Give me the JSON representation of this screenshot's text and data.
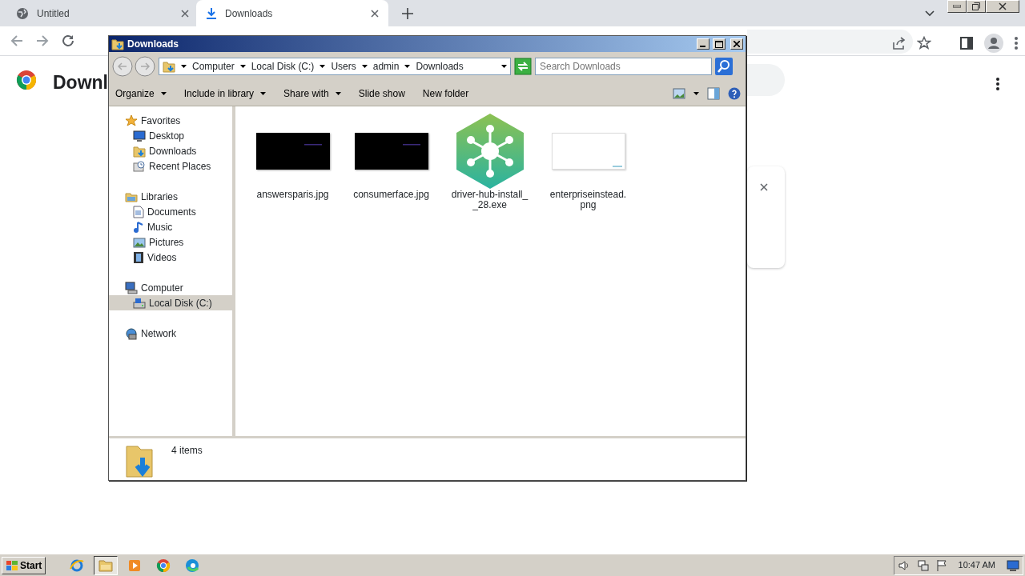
{
  "browser": {
    "tabs": [
      {
        "title": "Untitled",
        "kind": "globe",
        "selected": false
      },
      {
        "title": "Downloads",
        "kind": "download",
        "selected": true
      }
    ]
  },
  "page": {
    "title": "Downl"
  },
  "explorer": {
    "title": "Downloads",
    "breadcrumb": [
      "Computer",
      "Local Disk (C:)",
      "Users",
      "admin",
      "Downloads"
    ],
    "search": {
      "placeholder": "Search Downloads"
    },
    "commands": [
      {
        "label": "Organize",
        "dropdown": true
      },
      {
        "label": "Include in library",
        "dropdown": true
      },
      {
        "label": "Share with",
        "dropdown": true
      },
      {
        "label": "Slide show",
        "dropdown": false
      },
      {
        "label": "New folder",
        "dropdown": false
      }
    ],
    "sidebar": [
      {
        "label": "Favorites",
        "kind": "star",
        "selected": false,
        "children": [
          {
            "label": "Desktop",
            "kind": "desktop",
            "selected": false
          },
          {
            "label": "Downloads",
            "kind": "download-folder",
            "selected": false
          },
          {
            "label": "Recent Places",
            "kind": "recent",
            "selected": false
          }
        ]
      },
      {
        "label": "Libraries",
        "kind": "library",
        "selected": false,
        "children": [
          {
            "label": "Documents",
            "kind": "document",
            "selected": false
          },
          {
            "label": "Music",
            "kind": "music",
            "selected": false
          },
          {
            "label": "Pictures",
            "kind": "pictures",
            "selected": false
          },
          {
            "label": "Videos",
            "kind": "video",
            "selected": false
          }
        ]
      },
      {
        "label": "Computer",
        "kind": "computer",
        "selected": false,
        "children": [
          {
            "label": "Local Disk (C:)",
            "kind": "disk",
            "selected": true
          }
        ]
      },
      {
        "label": "Network",
        "kind": "network",
        "selected": false
      }
    ],
    "files": [
      {
        "name": "answersparis.jpg",
        "kind": "dark-image"
      },
      {
        "name": "consumerface.jpg",
        "kind": "dark-image"
      },
      {
        "name": "driver-hub-install__28.exe",
        "kind": "app"
      },
      {
        "name": "enterpriseinstead.png",
        "kind": "light-image"
      }
    ],
    "status": "4 items"
  },
  "taskbar": {
    "start": "Start",
    "apps": [
      {
        "kind": "ie",
        "active": false
      },
      {
        "kind": "folder",
        "active": true
      },
      {
        "kind": "media",
        "active": false
      },
      {
        "kind": "chrome",
        "active": false
      },
      {
        "kind": "edge",
        "active": false
      }
    ],
    "clock": "10:47 AM"
  }
}
